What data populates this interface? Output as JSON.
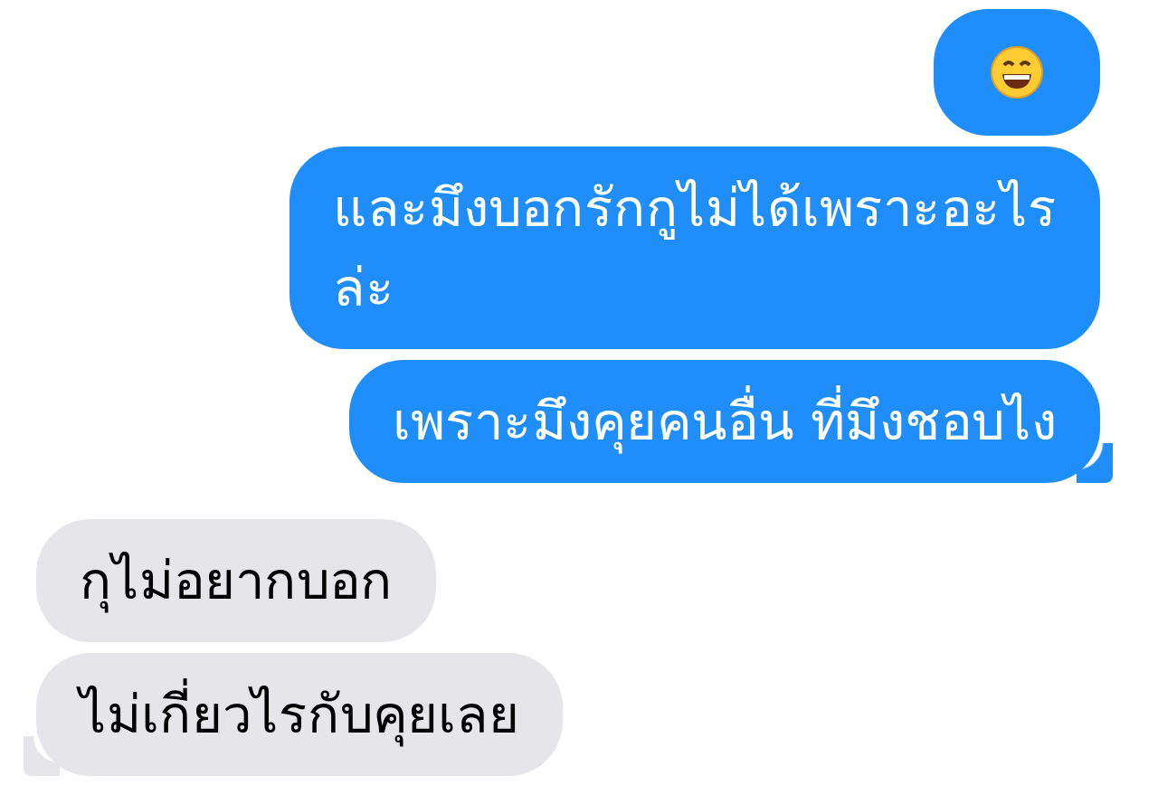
{
  "messages": [
    {
      "outgoing": true,
      "kind": "emoji",
      "tail": false
    },
    {
      "outgoing": true,
      "kind": "text",
      "text": "และมึงบอกรักกูไม่ได้เพราะอะไร\nล่ะ",
      "tail": false
    },
    {
      "outgoing": true,
      "kind": "text",
      "text": "เพราะมึงคุยคนอื่น ที่มึงชอบไง",
      "tail": true
    },
    {
      "outgoing": false,
      "kind": "text",
      "text": "กุไม่อยากบอก",
      "tail": false
    },
    {
      "outgoing": false,
      "kind": "text",
      "text": "ไม่เกี่ยวไรกับคุยเลย",
      "tail": true
    }
  ]
}
